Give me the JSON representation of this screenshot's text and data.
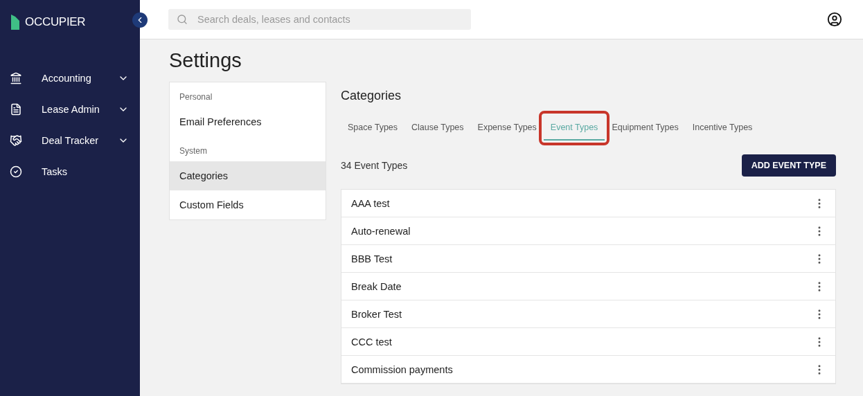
{
  "sidebar": {
    "brand": "OCCUPIER",
    "items": [
      {
        "label": "Accounting",
        "kind": "bank",
        "expandable": true
      },
      {
        "label": "Lease Admin",
        "kind": "document",
        "expandable": true
      },
      {
        "label": "Deal Tracker",
        "kind": "handshake",
        "expandable": true
      },
      {
        "label": "Tasks",
        "kind": "check",
        "expandable": false
      }
    ]
  },
  "search": {
    "placeholder": "Search deals, leases and contacts"
  },
  "page_title": "Settings",
  "settings_menu": [
    {
      "kind": "heading",
      "label": "Personal"
    },
    {
      "kind": "item",
      "label": "Email Preferences",
      "selected": false
    },
    {
      "kind": "heading",
      "label": "System"
    },
    {
      "kind": "item",
      "label": "Categories",
      "selected": true
    },
    {
      "kind": "item",
      "label": "Custom Fields",
      "selected": false
    }
  ],
  "section_title": "Categories",
  "tabs": [
    {
      "label": "Space Types",
      "selected": false,
      "annotated": false
    },
    {
      "label": "Clause Types",
      "selected": false,
      "annotated": false
    },
    {
      "label": "Expense Types",
      "selected": false,
      "annotated": false
    },
    {
      "label": "Event Types",
      "selected": true,
      "annotated": true
    },
    {
      "label": "Equipment Types",
      "selected": false,
      "annotated": false
    },
    {
      "label": "Incentive Types",
      "selected": false,
      "annotated": false
    }
  ],
  "count": "34 Event Types",
  "add_button": "ADD EVENT TYPE",
  "rows": [
    "AAA test",
    "Auto-renewal",
    "BBB Test",
    "Break Date",
    "Broker Test",
    "CCC test",
    "Commission payments"
  ]
}
